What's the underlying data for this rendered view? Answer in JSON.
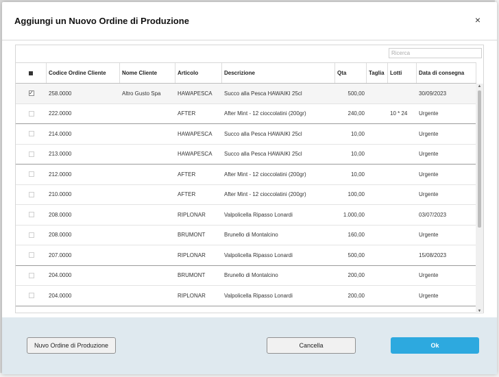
{
  "dialog": {
    "title": "Aggiungi un Nuovo Ordine di Produzione",
    "close_icon": "×"
  },
  "search": {
    "placeholder": "Ricerca",
    "value": ""
  },
  "table": {
    "columns": [
      "",
      "Codice Ordine Cliente",
      "Nome Cliente",
      "Articolo",
      "Descrizione",
      "Qta",
      "Taglia",
      "Lotti",
      "Data di consegna"
    ],
    "rows": [
      {
        "checked": true,
        "codice": "258.0000",
        "cliente": "Altro Gusto Spa",
        "articolo": "HAWAPESCA",
        "descrizione": "Succo alla Pesca HAWAIKI 25cl",
        "qta": "500,00",
        "taglia": "",
        "lotti": "",
        "data": "30/09/2023"
      },
      {
        "checked": false,
        "codice": "222.0000",
        "cliente": "",
        "articolo": "AFTER",
        "descrizione": "After Mint - 12 cioccolatini (200gr)",
        "qta": "240,00",
        "taglia": "",
        "lotti": "10 * 24",
        "data": "Urgente"
      },
      {
        "checked": false,
        "codice": "214.0000",
        "cliente": "",
        "articolo": "HAWAPESCA",
        "descrizione": "Succo alla Pesca HAWAIKI 25cl",
        "qta": "10,00",
        "taglia": "",
        "lotti": "",
        "data": "Urgente"
      },
      {
        "checked": false,
        "codice": "213.0000",
        "cliente": "",
        "articolo": "HAWAPESCA",
        "descrizione": "Succo alla Pesca HAWAIKI 25cl",
        "qta": "10,00",
        "taglia": "",
        "lotti": "",
        "data": "Urgente"
      },
      {
        "checked": false,
        "codice": "212.0000",
        "cliente": "",
        "articolo": "AFTER",
        "descrizione": "After Mint - 12 cioccolatini (200gr)",
        "qta": "10,00",
        "taglia": "",
        "lotti": "",
        "data": "Urgente"
      },
      {
        "checked": false,
        "codice": "210.0000",
        "cliente": "",
        "articolo": "AFTER",
        "descrizione": "After Mint - 12 cioccolatini (200gr)",
        "qta": "100,00",
        "taglia": "",
        "lotti": "",
        "data": "Urgente"
      },
      {
        "checked": false,
        "codice": "208.0000",
        "cliente": "",
        "articolo": "RIPLONAR",
        "descrizione": "Valpolicella Ripasso Lonardi",
        "qta": "1.000,00",
        "taglia": "",
        "lotti": "",
        "data": "03/07/2023"
      },
      {
        "checked": false,
        "codice": "208.0000",
        "cliente": "",
        "articolo": "BRUMONT",
        "descrizione": "Brunello di Montalcino",
        "qta": "160,00",
        "taglia": "",
        "lotti": "",
        "data": "Urgente"
      },
      {
        "checked": false,
        "codice": "207.0000",
        "cliente": "",
        "articolo": "RIPLONAR",
        "descrizione": "Valpolicella Ripasso Lonardi",
        "qta": "500,00",
        "taglia": "",
        "lotti": "",
        "data": "15/08/2023"
      },
      {
        "checked": false,
        "codice": "204.0000",
        "cliente": "",
        "articolo": "BRUMONT",
        "descrizione": "Brunello di Montalcino",
        "qta": "200,00",
        "taglia": "",
        "lotti": "",
        "data": "Urgente"
      },
      {
        "checked": false,
        "codice": "204.0000",
        "cliente": "",
        "articolo": "RIPLONAR",
        "descrizione": "Valpolicella Ripasso Lonardi",
        "qta": "200,00",
        "taglia": "",
        "lotti": "",
        "data": "Urgente"
      }
    ]
  },
  "footer": {
    "new_label": "Nuvo Ordine di Produzione",
    "cancel_label": "Cancella",
    "ok_label": "Ok"
  },
  "colors": {
    "ok_button": "#2da9df",
    "footer_bg": "#dfe9ef"
  }
}
